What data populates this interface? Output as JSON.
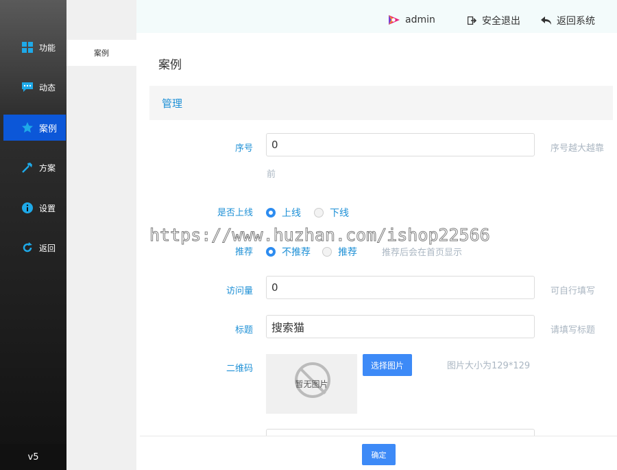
{
  "sidebar": {
    "items": [
      {
        "label": "功能",
        "icon": "grid-icon"
      },
      {
        "label": "动态",
        "icon": "chat-icon"
      },
      {
        "label": "案例",
        "icon": "star-icon"
      },
      {
        "label": "方案",
        "icon": "hammer-icon"
      },
      {
        "label": "设置",
        "icon": "info-icon"
      },
      {
        "label": "返回",
        "icon": "refresh-icon"
      }
    ],
    "active_index": 2,
    "version": "v5"
  },
  "subnav": {
    "item": "案例"
  },
  "header": {
    "user": "admin",
    "logout": "安全退出",
    "back": "返回系统"
  },
  "page": {
    "title": "案例",
    "section": "管理"
  },
  "form": {
    "order": {
      "label": "序号",
      "value": "0",
      "hint": "序号越大越靠",
      "hint2": "前"
    },
    "online": {
      "label": "是否上线",
      "options": [
        "上线",
        "下线"
      ],
      "selected": "上线"
    },
    "recommend": {
      "label": "推荐",
      "options": [
        "不推荐",
        "推荐"
      ],
      "selected": "不推荐",
      "hint": "推荐后会在首页显示"
    },
    "visits": {
      "label": "访问量",
      "value": "0",
      "hint": "可自行填写"
    },
    "title": {
      "label": "标题",
      "value": "搜索猫",
      "hint": "请填写标题"
    },
    "qrcode": {
      "label": "二维码",
      "placeholder_text": "暂无图片",
      "button": "选择图片",
      "hint": "图片大小为129*129"
    }
  },
  "footer": {
    "confirm": "确定"
  },
  "watermark": "https://www.huzhan.com/ishop22566",
  "colors": {
    "accent": "#1e90d6",
    "active_nav": "#0c57d8",
    "button": "#3d8af7"
  }
}
